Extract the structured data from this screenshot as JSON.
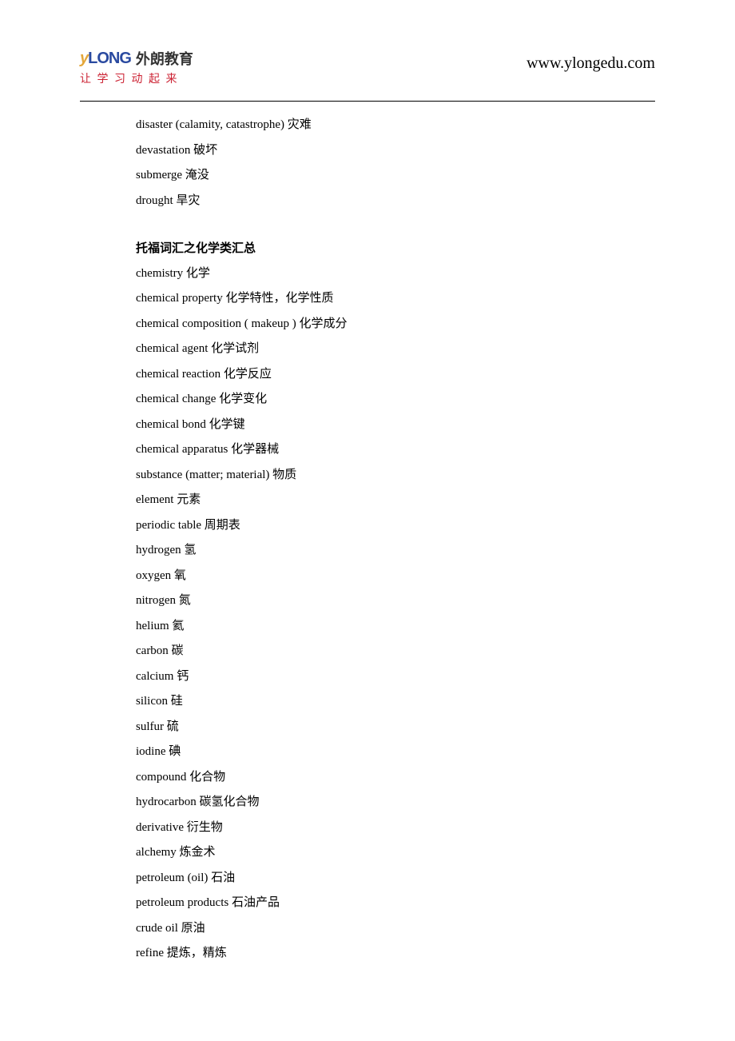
{
  "header": {
    "logo_mark_y": "y",
    "logo_mark_long": "LONG",
    "logo_cn": "外朗教育",
    "logo_sub": "让 学 习 动 起 来",
    "site_url": "www.ylongedu.com"
  },
  "intro_lines": [
    "disaster (calamity, catastrophe) 灾难",
    "devastation 破坏",
    "submerge 淹没",
    "drought 旱灾"
  ],
  "section_title": "托福词汇之化学类汇总",
  "vocab_lines": [
    "chemistry 化学",
    "chemical property 化学特性，化学性质",
    "chemical composition ( makeup ) 化学成分",
    "chemical agent 化学试剂",
    "chemical reaction 化学反应",
    "chemical change 化学变化",
    "chemical bond 化学键",
    "chemical apparatus 化学器械",
    "substance (matter; material) 物质",
    "element 元素",
    "periodic table 周期表",
    "hydrogen 氢",
    "oxygen 氧",
    "nitrogen 氮",
    "helium 氦",
    "carbon 碳",
    "calcium 钙",
    "silicon 硅",
    "sulfur 硫",
    "iodine 碘",
    "compound 化合物",
    "hydrocarbon 碳氢化合物",
    "derivative 衍生物",
    "alchemy 炼金术",
    "petroleum (oil) 石油",
    "petroleum products 石油产品",
    "crude oil 原油",
    "refine 提炼，精炼"
  ]
}
